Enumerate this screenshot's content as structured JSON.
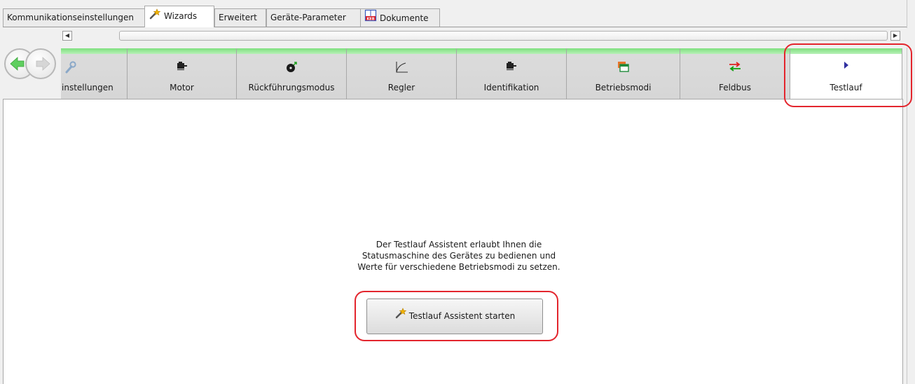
{
  "tabs": [
    {
      "label": "Kommunikationseinstellungen",
      "icon": "none",
      "active": false
    },
    {
      "label": "Wizards",
      "icon": "wand-icon",
      "active": true
    },
    {
      "label": "Erweitert",
      "icon": "none",
      "active": false
    },
    {
      "label": "Geräte-Parameter",
      "icon": "none",
      "active": false
    },
    {
      "label": "Dokumente",
      "icon": "keb-book-icon",
      "active": false
    }
  ],
  "scroll": {
    "left_arrow": "◀",
    "right_arrow": "▶"
  },
  "steps": [
    {
      "label": "instellungen",
      "icon": "wrench-icon"
    },
    {
      "label": "Motor",
      "icon": "motor-icon"
    },
    {
      "label": "Rückführungsmodus",
      "icon": "encoder-icon"
    },
    {
      "label": "Regler",
      "icon": "curve-icon"
    },
    {
      "label": "Identifikation",
      "icon": "motor-icon"
    },
    {
      "label": "Betriebsmodi",
      "icon": "modes-icon"
    },
    {
      "label": "Feldbus",
      "icon": "arrows-exchange-icon"
    },
    {
      "label": "Testlauf",
      "icon": "play-icon"
    }
  ],
  "active_step": "Testlauf",
  "description": {
    "line1": "Der Testlauf Assistent erlaubt Ihnen die",
    "line2": "Statusmaschine des Gerätes zu bedienen und",
    "line3": "Werte für verschiedene Betriebsmodi zu setzen."
  },
  "start_button": "Testlauf Assistent starten",
  "colors": {
    "accent_green": "#7ee07e",
    "highlight_red": "#e3252d",
    "feldbus_red": "#e02020",
    "feldbus_green": "#10a010",
    "play_blue": "#3030a0"
  }
}
